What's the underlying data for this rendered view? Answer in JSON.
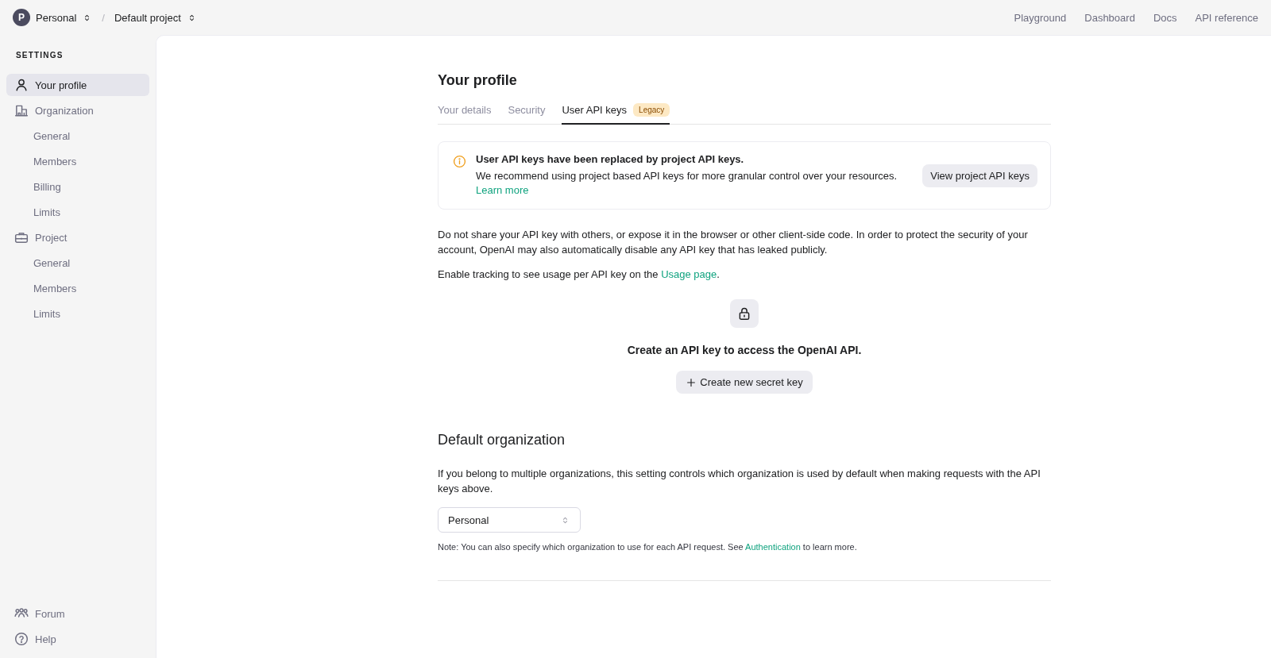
{
  "topbar": {
    "org": {
      "initial": "P",
      "label": "Personal"
    },
    "separator": "/",
    "project": "Default project",
    "links": [
      "Playground",
      "Dashboard",
      "Docs",
      "API reference"
    ]
  },
  "sidebar": {
    "heading": "SETTINGS",
    "items": [
      {
        "label": "Your profile",
        "selected": true
      },
      {
        "label": "Organization",
        "selected": false,
        "children": [
          {
            "label": "General",
            "selected": false
          },
          {
            "label": "Members",
            "selected": false
          },
          {
            "label": "Billing",
            "selected": false
          },
          {
            "label": "Limits",
            "selected": false
          }
        ]
      },
      {
        "label": "Project",
        "selected": false,
        "children": [
          {
            "label": "General",
            "selected": false
          },
          {
            "label": "Members",
            "selected": false
          },
          {
            "label": "Limits",
            "selected": false
          }
        ]
      }
    ],
    "footer": [
      "Forum",
      "Help"
    ]
  },
  "page": {
    "title": "Your profile",
    "tabs": [
      {
        "label": "Your details",
        "selected": false
      },
      {
        "label": "Security",
        "selected": false
      },
      {
        "label": "User API keys",
        "selected": true,
        "badge": "Legacy"
      }
    ],
    "notice": {
      "title": "User API keys have been replaced by project API keys.",
      "text": "We recommend using project based API keys for more granular control over your resources.",
      "link": "Learn more",
      "button": "View project API keys"
    },
    "warning": "Do not share your API key with others, or expose it in the browser or other client-side code. In order to protect the security of your account, OpenAI may also automatically disable any API key that has leaked publicly.",
    "tracking": {
      "text": "Enable tracking to see usage per API key on the",
      "link": "Usage page",
      "end": "."
    },
    "empty": {
      "text": "Create an API key to access the OpenAI API.",
      "button": "Create new secret key"
    },
    "default_org": {
      "title": "Default organization",
      "description": "If you belong to multiple organizations, this setting controls which organization is used by default when making requests with the API keys above.",
      "select": "Personal",
      "note": {
        "text": "Note: You can also specify which organization to use for each API request. See",
        "link": "Authentication",
        "end": "to learn more."
      }
    }
  }
}
